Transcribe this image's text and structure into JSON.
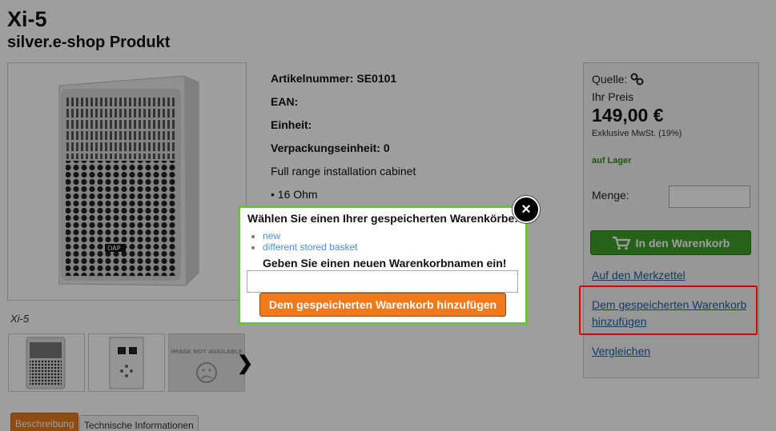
{
  "product": {
    "title": "Xi-5",
    "subtitle": "silver.e-shop Produkt",
    "image_caption": "Xi-5",
    "thumb_3_text": "IMAGE NOT AVAILABLE"
  },
  "specs": {
    "article_label": "Artikelnummer:",
    "article_value": "SE0101",
    "ean_label": "EAN:",
    "unit_label": "Einheit:",
    "pack_label": "Verpackungseinheit:",
    "pack_value": "0",
    "description": "Full range installation cabinet",
    "bullet_1": "• 16 Ohm"
  },
  "tabs": {
    "description": "Beschreibung",
    "technical": "Technische Informationen"
  },
  "buybox": {
    "source_label": "Quelle:",
    "price_label": "Ihr Preis",
    "price": "149,00 €",
    "vat_note": "Exklusive MwSt. (19%)",
    "stock": "auf Lager",
    "qty_label": "Menge:",
    "cart_button": "In den Warenkorb",
    "wishlist_link": "Auf den Merkzettel",
    "saved_basket_link": "Dem gespeicherten Warenkorb hinzufügen",
    "compare_link": "Vergleichen"
  },
  "dialog": {
    "title": "Wählen Sie einen Ihrer gespeicherten Warenkörbe:",
    "baskets": [
      "new",
      "different stored basket"
    ],
    "new_name_label": "Geben Sie einen neuen Warenkorbnamen ein!",
    "add_button": "Dem gespeicherten Warenkorb hinzufügen",
    "close_symbol": "×"
  },
  "icons": {
    "source": "link-chain-icon",
    "cart": "shopping-cart-icon",
    "next": "chevron-right-icon",
    "close": "close-icon"
  },
  "colors": {
    "cart_green": "#3f9e2b",
    "dialog_border": "#6cc32a",
    "add_orange": "#f07a1a",
    "highlight_red": "#e00000",
    "link_blue": "#1d5fa8"
  }
}
